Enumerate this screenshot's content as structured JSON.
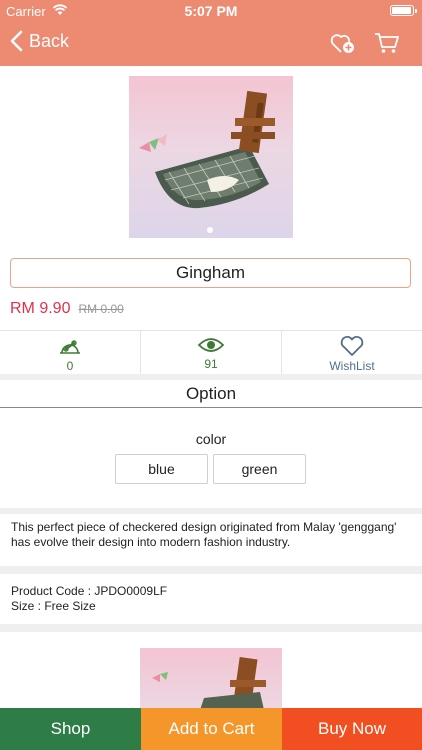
{
  "status_bar": {
    "carrier": "Carrier",
    "time": "5:07 PM",
    "battery_level": 0.9
  },
  "nav": {
    "back_label": "Back",
    "accent": "#ec8a72"
  },
  "product": {
    "title": "Gingham",
    "price": "RM 9.90",
    "original_price": "RM 0.00",
    "price_color": "#e0314a"
  },
  "stats": [
    {
      "icon": "share-link-icon",
      "value": "0"
    },
    {
      "icon": "eye-icon",
      "value": "91"
    },
    {
      "icon": "heart-icon",
      "value": "WishList"
    }
  ],
  "options": {
    "heading": "Option",
    "group_label": "color",
    "choices": [
      "blue",
      "green"
    ]
  },
  "description": "This perfect piece of checkered design originated from Malay 'genggang' has evolve their design into modern fashion industry.",
  "details": {
    "product_code": "Product Code : JPDO0009LF",
    "size": "Size : Free Size"
  },
  "bottom_bar": {
    "shop": "Shop",
    "add_to_cart": "Add to Cart",
    "buy_now": "Buy Now",
    "shop_color": "#2e7d46",
    "cart_color": "#f5962a",
    "buy_color": "#f14f22"
  }
}
